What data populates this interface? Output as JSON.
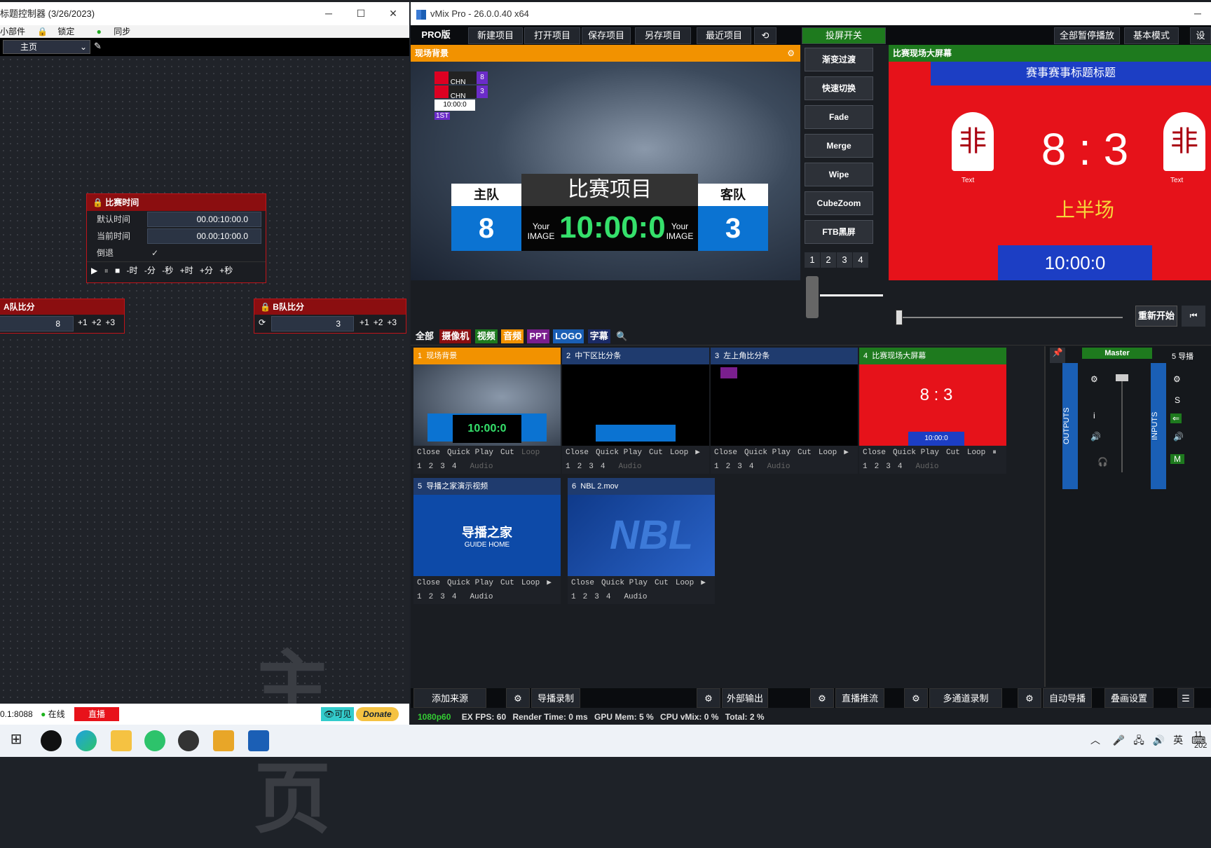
{
  "left": {
    "title": "标题控制器 (3/26/2023)",
    "menu": [
      "小部件",
      "锁定",
      "同步"
    ],
    "page_select": "主页",
    "watermark": "主页",
    "timer": {
      "title": "比赛时间",
      "default_label": "默认时间",
      "default_value": "00.00:10:00.0",
      "current_label": "当前时间",
      "current_value": "00.00:10:00.0",
      "reverse_label": "倒退",
      "controls": [
        "-时",
        "-分",
        "-秒",
        "+时",
        "+分",
        "+秒"
      ]
    },
    "teamA": {
      "title": "A队比分",
      "value": "8",
      "btns": [
        "+1",
        "+2",
        "+3"
      ]
    },
    "teamB": {
      "title": "B队比分",
      "value": "3",
      "btns": [
        "+1",
        "+2",
        "+3"
      ]
    },
    "status": {
      "address": "0.1:8088",
      "online": "在线",
      "live": "直播",
      "visible": "可见",
      "donate": "Donate"
    }
  },
  "vmix": {
    "title": "vMix Pro - 26.0.0.40 x64",
    "toolbar": [
      "PRO版",
      "新建项目",
      "打开项目",
      "保存项目",
      "另存项目",
      "最近项目"
    ],
    "cast": "投屏开关",
    "stop_all": "全部暂停播放",
    "basic_mode": "基本模式",
    "preview": {
      "title": "现场背景",
      "flags": [
        {
          "team": "CHN",
          "score": "8"
        },
        {
          "team": "CHN",
          "score": "3"
        }
      ],
      "mini_time": "10:00:0",
      "period": "1ST",
      "home": "主队",
      "away": "客队",
      "event": "比赛项目",
      "home_score": "8",
      "away_score": "3",
      "clock": "10:00:0",
      "your_image": "Your IMAGE"
    },
    "transitions": [
      "渐变过渡",
      "快速切换",
      "Fade",
      "Merge",
      "Wipe",
      "CubeZoom",
      "FTB黑屏"
    ],
    "trans_nums": [
      "1",
      "2",
      "3",
      "4"
    ],
    "output": {
      "title": "比赛现场大屏幕",
      "banner": "赛事赛事标题标题",
      "score": "8 : 3",
      "half": "上半场",
      "time": "10:00:0",
      "logo_text": "Text"
    },
    "restart": "重新开始",
    "tabs": [
      "全部",
      "摄像机",
      "视频",
      "音频",
      "PPT",
      "LOGO",
      "字幕"
    ],
    "inputs": [
      {
        "n": "1",
        "name": "现场背景"
      },
      {
        "n": "2",
        "name": "中下区比分条"
      },
      {
        "n": "3",
        "name": "左上角比分条"
      },
      {
        "n": "4",
        "name": "比赛现场大屏幕"
      },
      {
        "n": "5",
        "name": "导播之家演示视频"
      },
      {
        "n": "6",
        "name": "NBL 2.mov"
      }
    ],
    "input_ctrl": [
      "Close",
      "Quick Play",
      "Cut",
      "Loop"
    ],
    "nums": [
      "1",
      "2",
      "3",
      "4"
    ],
    "audio": "Audio",
    "guide_title": "导播之家",
    "guide_sub": "GUIDE HOME",
    "nbl": "NBL",
    "mixer": {
      "master": "Master",
      "outputs": "OUTPUTS",
      "inputs": "INPUTS",
      "ch5": "5",
      "ch5name": "导播"
    },
    "bottom": [
      "添加来源",
      "导播录制",
      "外部输出",
      "直播推流",
      "多通道录制",
      "自动导播",
      "叠画设置"
    ],
    "stats": {
      "res": "1080p60",
      "ex": "EX",
      "fps_l": "FPS:",
      "fps": "60",
      "rt_l": "Render Time:",
      "rt": "0 ms",
      "gpu_l": "GPU Mem:",
      "gpu": "5 %",
      "cpu_l": "CPU vMix:",
      "cpu": "0 %",
      "tot_l": "Total:",
      "tot": "2 %"
    }
  },
  "taskbar": {
    "lang": "英",
    "time": "11",
    "date": "202"
  },
  "colors": {
    "red_panel": "#8b0e10",
    "accent_green": "#1e8a1e",
    "orange": "#f29200"
  }
}
